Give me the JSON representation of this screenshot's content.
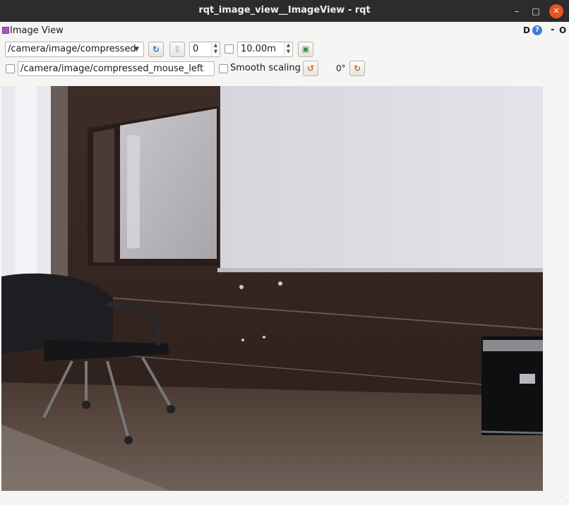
{
  "window": {
    "title": "rqt_image_view__ImageView - rqt",
    "minimize": "–",
    "maximize": "□",
    "close": "✕"
  },
  "plugin": {
    "title": "Image View",
    "d_label": "D",
    "help_label": "?",
    "dash_label": "-",
    "o_label": "O"
  },
  "toolbar": {
    "topic_selected": "/camera/image/compressed",
    "frame_skip_value": "0",
    "max_range_value": "10.00m",
    "mouse_topic_value": "/camera/image/compressed_mouse_left",
    "smooth_scaling_label": "Smooth scaling",
    "rotation_label": "0°"
  },
  "icons": {
    "refresh": "refresh-icon",
    "pause": "pause-icon",
    "save": "save-icon",
    "rotate_left": "rotate-left-icon",
    "rotate_right": "rotate-right-icon"
  },
  "colors": {
    "titlebar": "#2c2c2c",
    "close_button": "#e95420",
    "window_bg": "#f6f5f4"
  }
}
